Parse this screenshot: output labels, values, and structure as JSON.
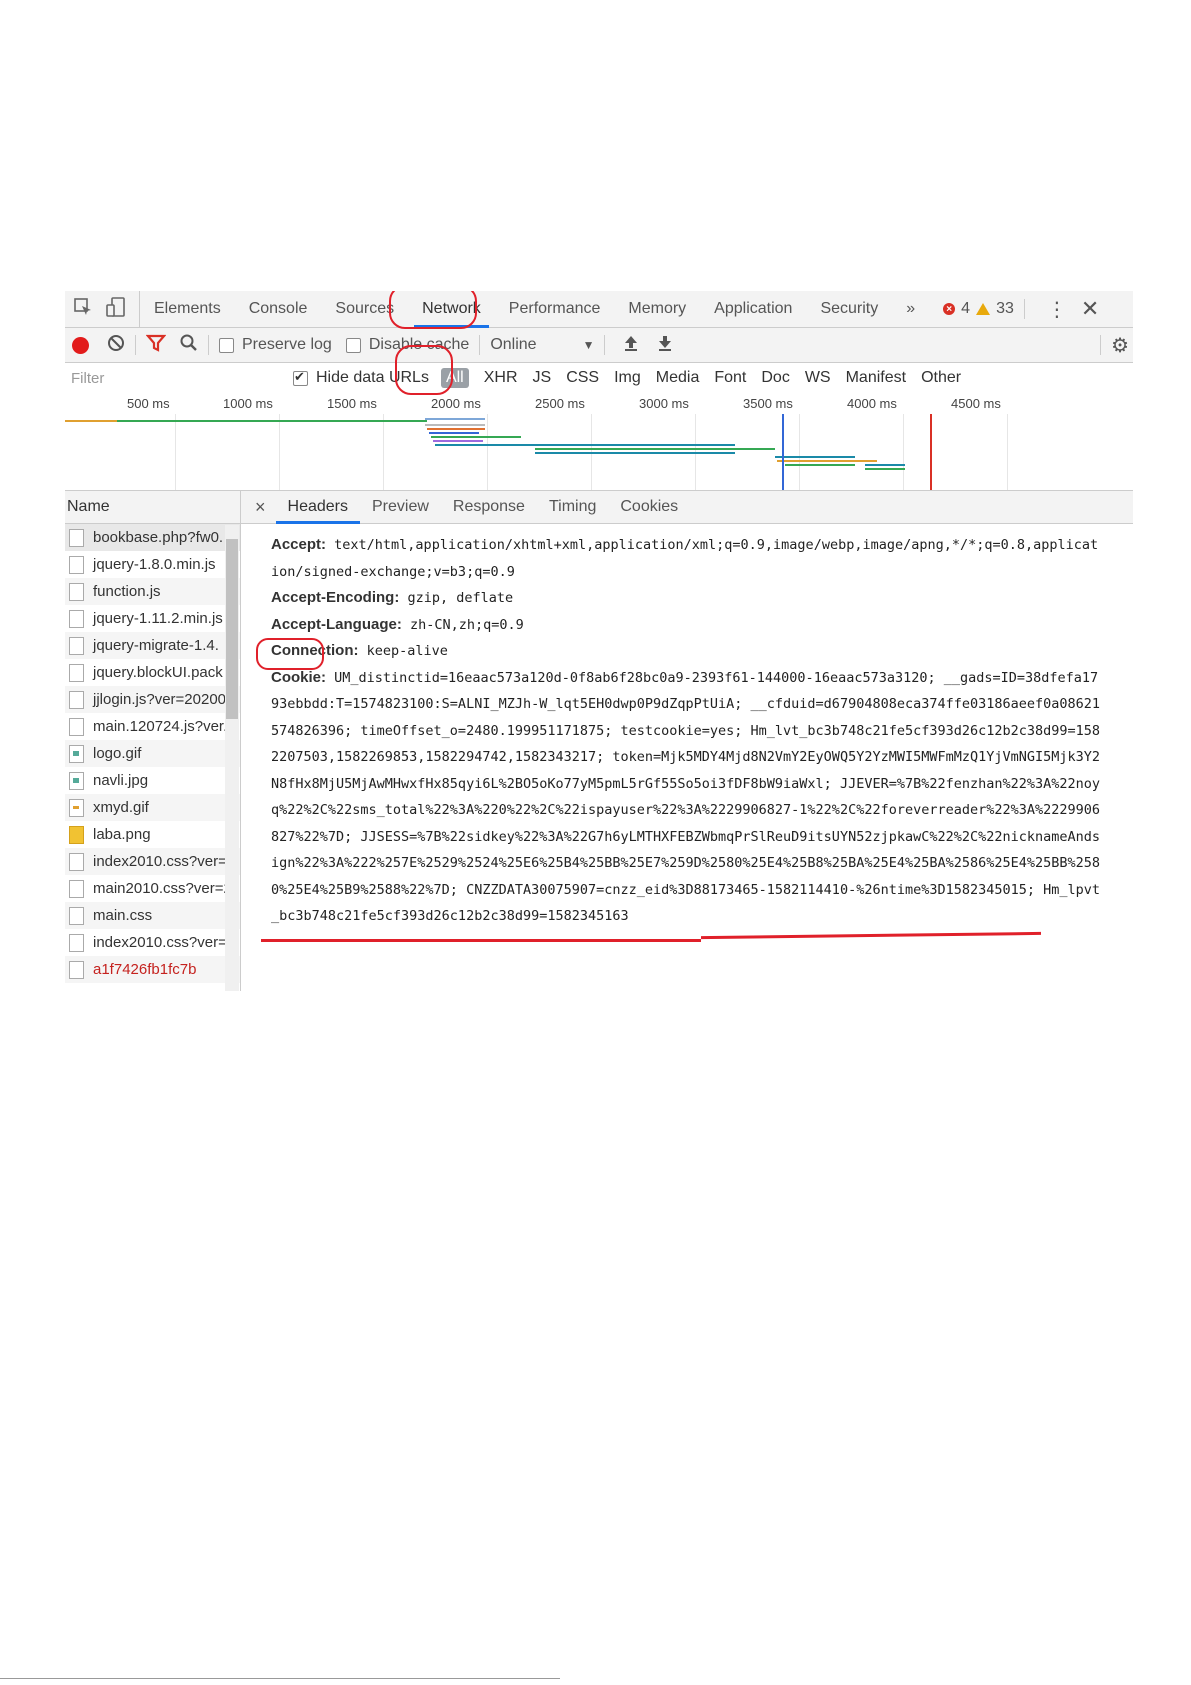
{
  "main_tabs": [
    "Elements",
    "Console",
    "Sources",
    "Network",
    "Performance",
    "Memory",
    "Application",
    "Security"
  ],
  "active_tab": "Network",
  "more_tabs_icon": "»",
  "error_count": "4",
  "warning_count": "33",
  "toolbar": {
    "preserve_log": "Preserve log",
    "disable_cache": "Disable cache",
    "throttling": "Online"
  },
  "filter": {
    "placeholder": "Filter",
    "hide_data_urls": "Hide data URLs",
    "types": [
      "All",
      "XHR",
      "JS",
      "CSS",
      "Img",
      "Media",
      "Font",
      "Doc",
      "WS",
      "Manifest",
      "Other"
    ]
  },
  "timeline": {
    "ticks": [
      "500 ms",
      "1000 ms",
      "1500 ms",
      "2000 ms",
      "2500 ms",
      "3000 ms",
      "3500 ms",
      "4000 ms",
      "4500 ms"
    ]
  },
  "name_header": "Name",
  "requests": [
    "bookbase.php?fw0.",
    "jquery-1.8.0.min.js",
    "function.js",
    "jquery-1.11.2.min.js",
    "jquery-migrate-1.4.",
    "jquery.blockUI.pack",
    "jjlogin.js?ver=20200",
    "main.120724.js?ver.",
    "logo.gif",
    "navli.jpg",
    "xmyd.gif",
    "laba.png",
    "index2010.css?ver=",
    "main2010.css?ver=2",
    "main.css",
    "index2010.css?ver=",
    "a1f7426fb1fc7b"
  ],
  "detail_tabs": [
    "Headers",
    "Preview",
    "Response",
    "Timing",
    "Cookies"
  ],
  "headers": [
    {
      "key": "Accept:",
      "value": "text/html,application/xhtml+xml,application/xml;q=0.9,image/webp,image/apng,*/*;q=0.8,application/signed-exchange;v=b3;q=0.9"
    },
    {
      "key": "Accept-Encoding:",
      "value": "gzip, deflate"
    },
    {
      "key": "Accept-Language:",
      "value": "zh-CN,zh;q=0.9"
    },
    {
      "key": "Connection:",
      "value": "keep-alive"
    },
    {
      "key": "Cookie:",
      "value": "UM_distinctid=16eaac573a120d-0f8ab6f28bc0a9-2393f61-144000-16eaac573a3120; __gads=ID=38dfefa1793ebbdd:T=1574823100:S=ALNI_MZJh-W_lqt5EH0dwp0P9dZqpPtUiA; __cfduid=d67904808eca374ffe03186aeef0a08621574826396; timeOffset_o=2480.199951171875; testcookie=yes; Hm_lvt_bc3b748c21fe5cf393d26c12b2c38d99=1582207503,1582269853,1582294742,1582343217; token=Mjk5MDY4Mjd8N2VmY2EyOWQ5Y2YzMWI5MWFmMzQ1YjVmNGI5Mjk3Y2N8fHx8MjU5MjAwMHwxfHx85qyi6L%2BO5oKo77yM5pmL5rGf55So5oi3fDF8bW9iaWxl; JJEVER=%7B%22fenzhan%22%3A%22noyq%22%2C%22sms_total%22%3A%220%22%2C%22ispayuser%22%3A%2229906827-1%22%2C%22foreverreader%22%3A%2229906827%22%7D; JJSESS=%7B%22sidkey%22%3A%22G7h6yLMTHXFEBZWbmqPrSlReuD9itsUYN52zjpkawC%22%2C%22nicknameAndsign%22%3A%222%257E%2529%2524%25E6%25B4%25BB%25E7%259D%2580%25E4%25B8%25BA%25E4%25BA%2586%25E4%25BB%2580%25E4%25B9%2588%22%7D; CNZZDATA30075907=cnzz_eid%3D88173465-1582114410-%26ntime%3D1582345015; Hm_lpvt_bc3b748c21fe5cf393d26c12b2c38d99=1582345163"
    }
  ],
  "colors": {
    "annotation_red": "#e0202a",
    "active_tab_blue": "#1a73e8",
    "record_red": "#e21b1b",
    "filter_red": "#d93025"
  }
}
